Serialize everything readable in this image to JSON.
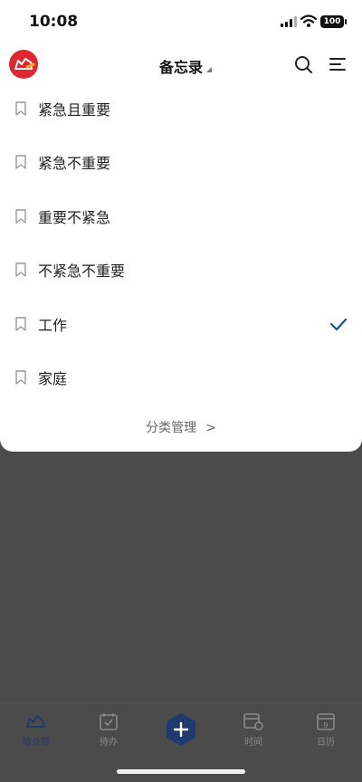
{
  "status_bar": {
    "time": "10:08",
    "battery": "100"
  },
  "header": {
    "title": "备忘录"
  },
  "categories": [
    {
      "label": "紧急且重要",
      "selected": false
    },
    {
      "label": "紧急不重要",
      "selected": false
    },
    {
      "label": "重要不紧急",
      "selected": false
    },
    {
      "label": "不紧急不重要",
      "selected": false
    },
    {
      "label": "工作",
      "selected": true
    },
    {
      "label": "家庭",
      "selected": false
    }
  ],
  "manage": {
    "label": "分类管理",
    "chevron": ">"
  },
  "bottom_nav": {
    "items": [
      {
        "label": "敬业签",
        "active": true
      },
      {
        "label": "待办",
        "active": false
      },
      {
        "label": "时间",
        "active": false
      },
      {
        "label": "日历",
        "active": false
      }
    ],
    "calendar_day": "9"
  },
  "colors": {
    "accent": "#1f4f8f",
    "logo_red": "#e0262e",
    "overlay": "#4b4b4b"
  }
}
